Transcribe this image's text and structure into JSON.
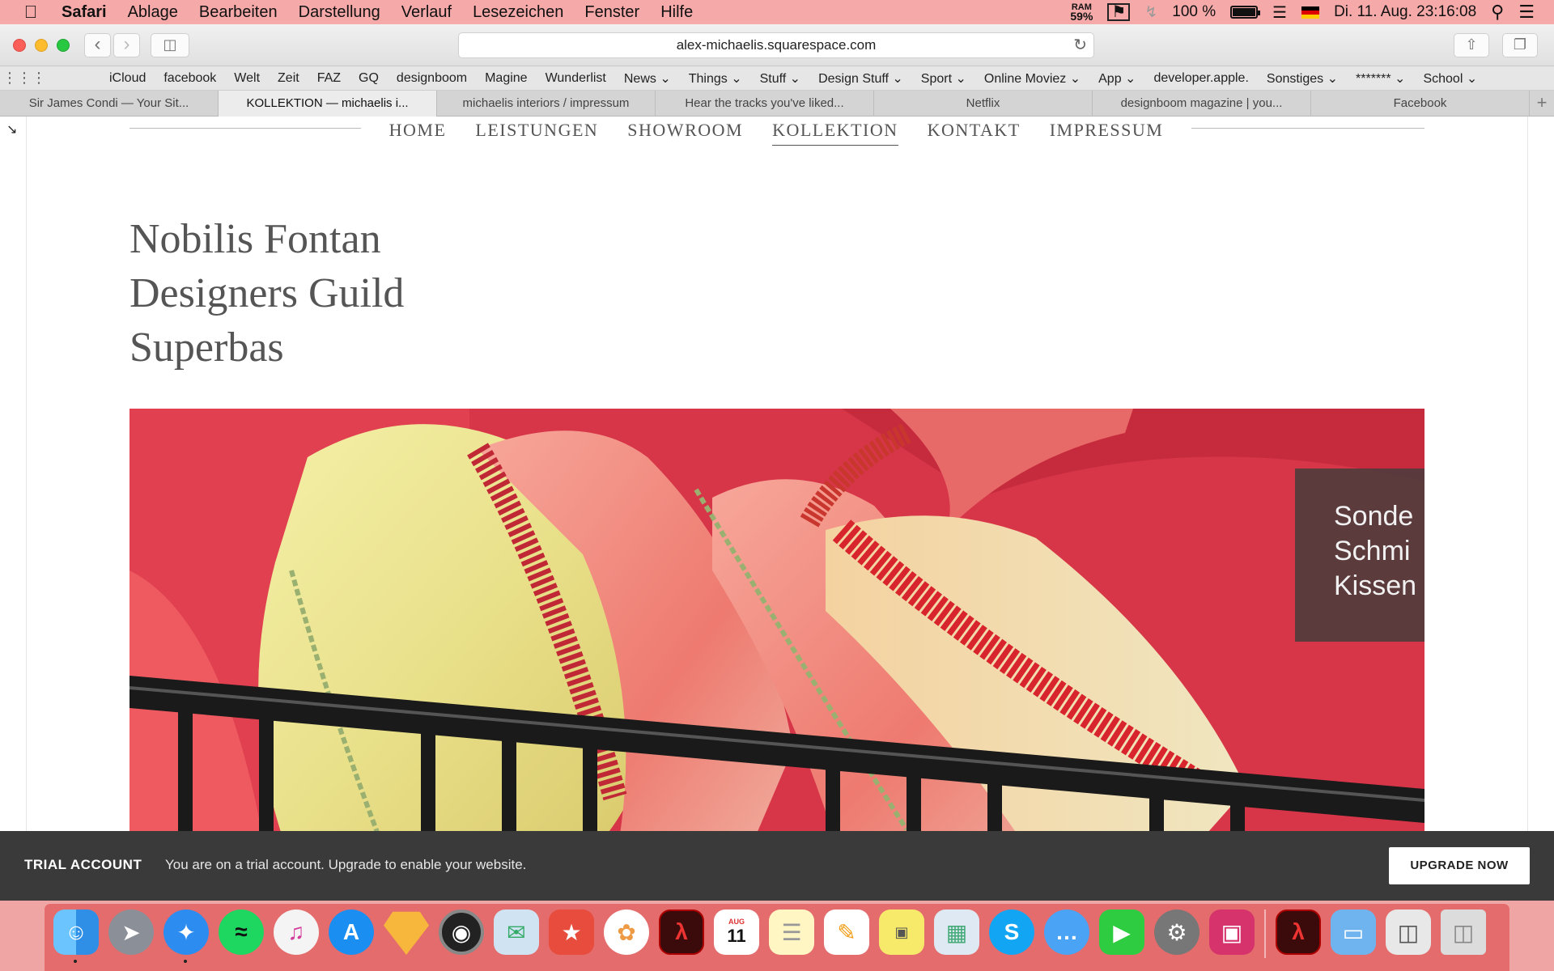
{
  "menubar": {
    "app": "Safari",
    "items": [
      "Ablage",
      "Bearbeiten",
      "Darstellung",
      "Verlauf",
      "Lesezeichen",
      "Fenster",
      "Hilfe"
    ],
    "ram_label": "RAM",
    "ram_value": "59%",
    "battery": "100 %",
    "clock": "Di. 11. Aug.  23:16:08"
  },
  "toolbar": {
    "url": "alex-michaelis.squarespace.com"
  },
  "bookmarks": [
    "iCloud",
    "facebook",
    "Welt",
    "Zeit",
    "FAZ",
    "GQ",
    "designboom",
    "Magine",
    "Wunderlist",
    "News ⌄",
    "Things ⌄",
    "Stuff ⌄",
    "Design Stuff ⌄",
    "Sport ⌄",
    "Online Moviez ⌄",
    "App ⌄",
    "developer.apple.",
    "Sonstiges ⌄",
    "******* ⌄",
    "School ⌄"
  ],
  "tabs": [
    "Sir James Condi — Your Sit...",
    "KOLLEKTION — michaelis i...",
    "michaelis interiors / impressum",
    "Hear the tracks you've liked...",
    "Netflix",
    "designboom magazine | you...",
    "Facebook"
  ],
  "site": {
    "nav": [
      "HOME",
      "LEISTUNGEN",
      "SHOWROOM",
      "KOLLEKTION",
      "KONTAKT",
      "IMPRESSUM"
    ],
    "active_nav": "KOLLEKTION",
    "title_lines": [
      "Nobilis Fontan",
      "Designers Guild",
      "Superbas"
    ],
    "caption_lines": [
      "Sonde",
      "Schmi",
      "Kissen"
    ]
  },
  "trial": {
    "label": "TRIAL ACCOUNT",
    "message": "You are on a trial account. Upgrade to enable your website.",
    "button": "UPGRADE NOW"
  },
  "dock": {
    "apps": [
      "Finder",
      "Launchpad",
      "Safari",
      "Spotify",
      "iTunes",
      "App Store",
      "Sketch",
      "Aperture",
      "Mail",
      "Wunderlist",
      "Photos",
      "Acrobat",
      "Calendar",
      "Notes",
      "Pages",
      "Stickies",
      "Preview",
      "Skype",
      "Messages",
      "FaceTime",
      "System Preferences",
      "CleanMyMac",
      "Acrobat Reader",
      "Folder",
      "Archive",
      "Trash"
    ],
    "calendar_month": "AUG",
    "calendar_day": "11"
  },
  "colors": {
    "menubar": "#f5a9a8",
    "trial_banner": "#3a3a3a",
    "hero_red": "#d63244"
  }
}
